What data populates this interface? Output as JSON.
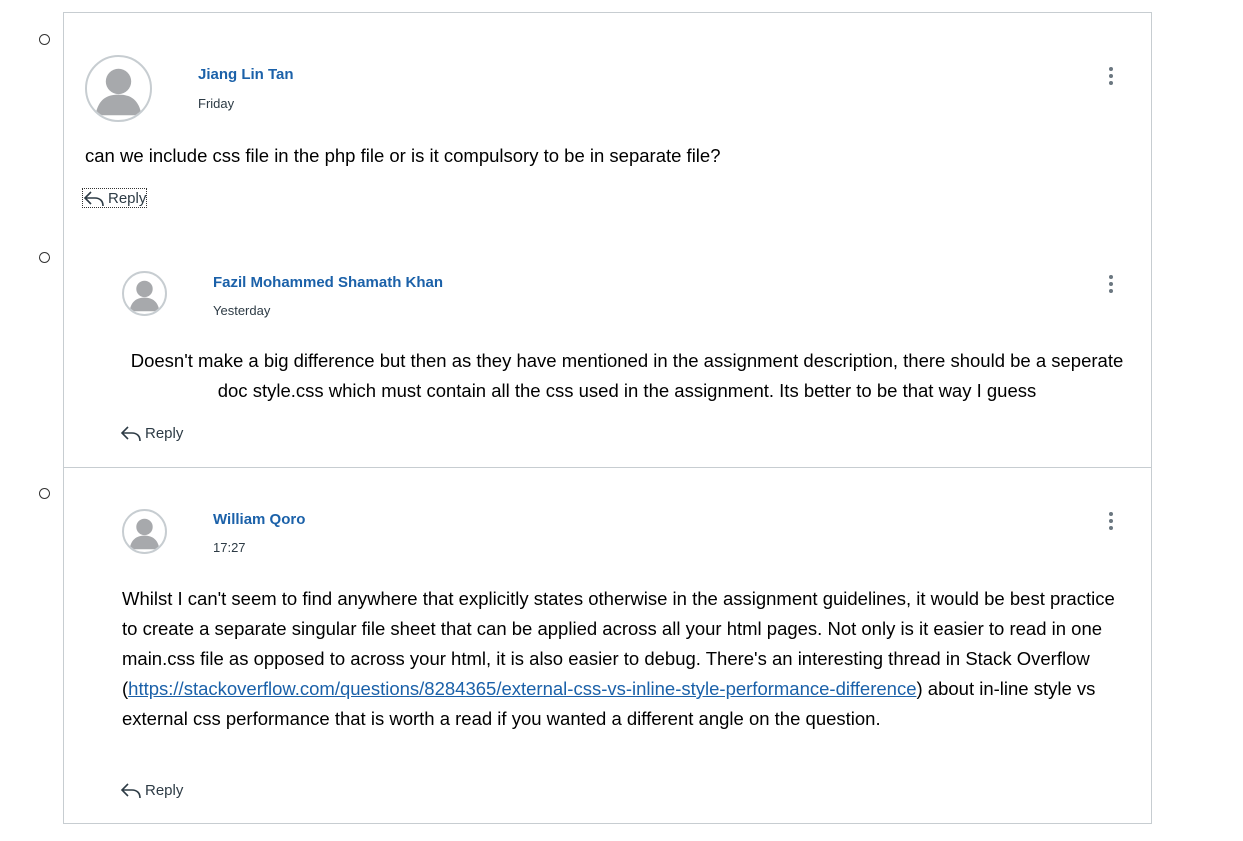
{
  "entries": [
    {
      "author": "Jiang Lin Tan",
      "time": "Friday",
      "message": "can we include css file in the php file or is it compulsory to be in separate file?",
      "reply_label": "Reply"
    },
    {
      "author": "Fazil Mohammed Shamath Khan",
      "time": "Yesterday",
      "message": "Doesn't make a big difference but then as they have mentioned in the assignment description, there should be a seperate doc style.css which must contain all the css used in the assignment. Its better to be that way I guess",
      "reply_label": "Reply"
    },
    {
      "author": "William Qoro",
      "time": "17:27",
      "message_part1": "Whilst I can't seem to find anywhere that explicitly states otherwise in the assignment guidelines, it would be best practice to create a separate singular file sheet that can be applied across all your html pages. Not only is it easier to read in one main.css file as opposed to across your html, it is also easier to debug. There's an interesting thread in Stack Overflow (",
      "link_text": "https://stackoverflow.com/questions/8284365/external-css-vs-inline-style-performance-difference",
      "message_part2": ") about in-line style vs external css performance that is worth a read if you wanted a different angle on the question.",
      "reply_label": "Reply"
    }
  ],
  "colors": {
    "author_link": "#1b61a9",
    "border": "#c7cdd1",
    "avatar_gray": "#a7a9ac"
  }
}
